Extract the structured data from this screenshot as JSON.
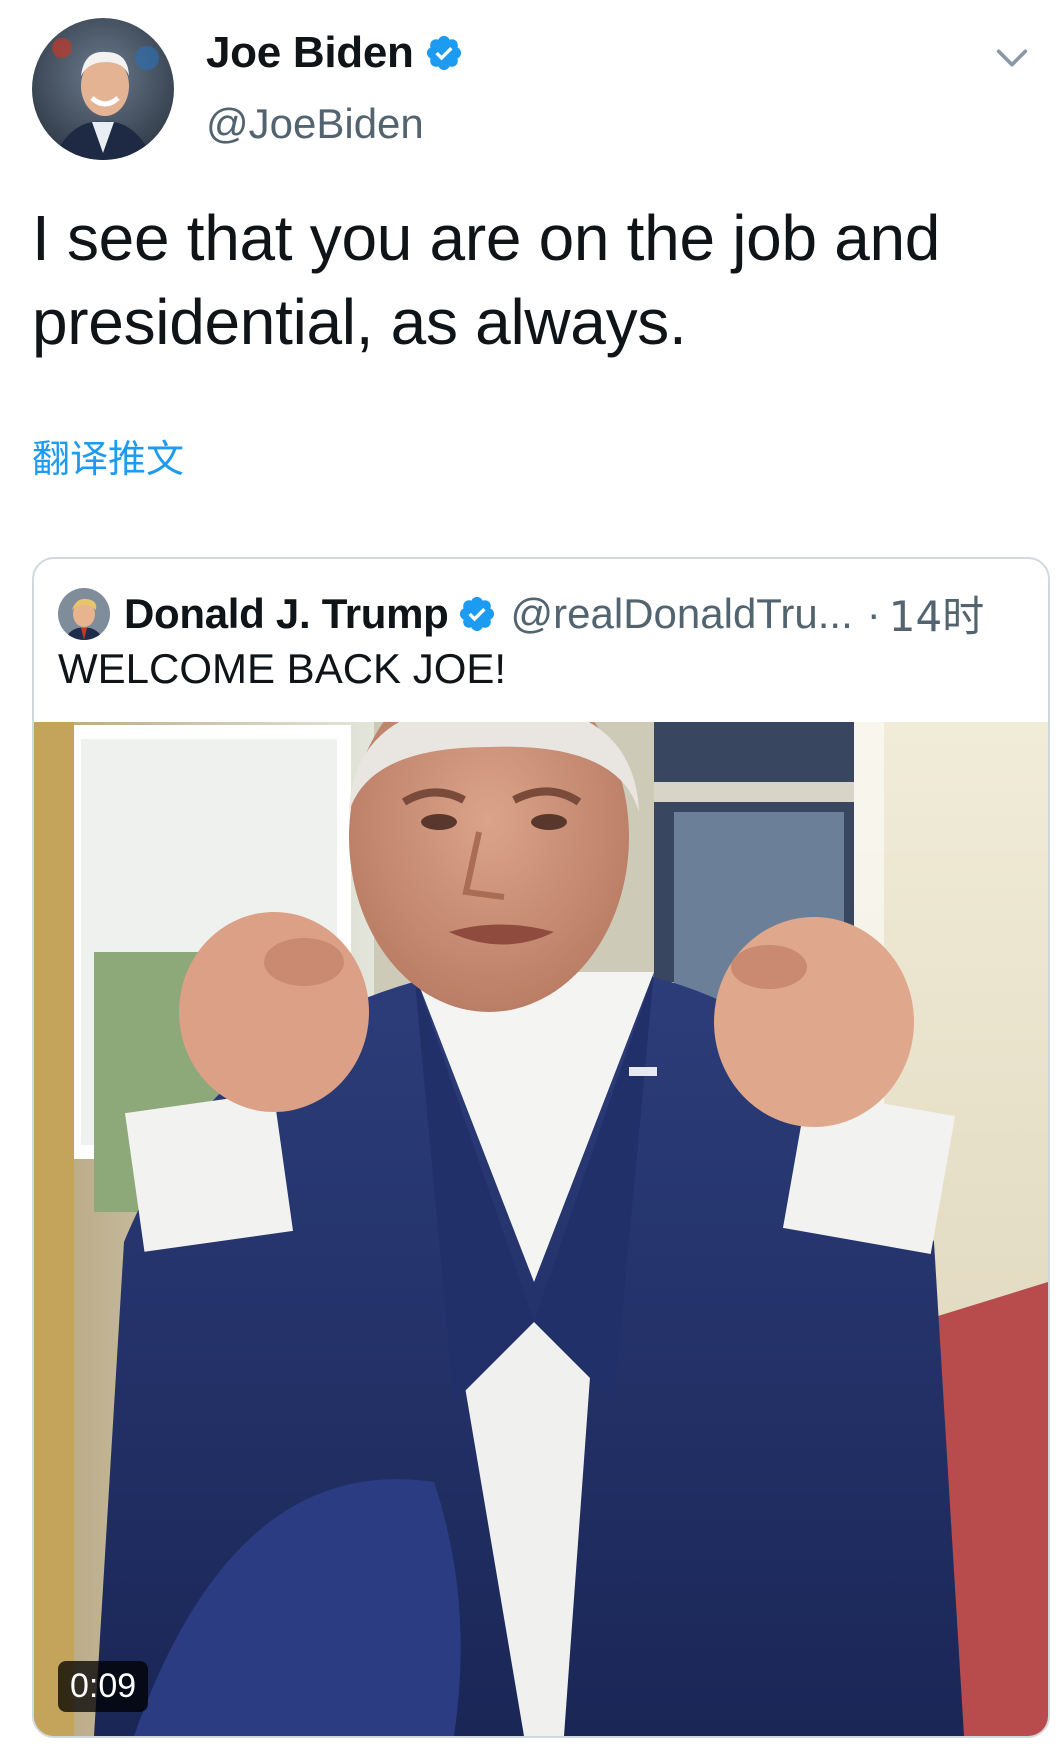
{
  "tweet": {
    "author": {
      "name": "Joe Biden",
      "handle": "@JoeBiden",
      "verified": true
    },
    "text": "I see that you are on the job and\npresidential, as always.",
    "translate_label": "翻译推文",
    "menu_icon": "chevron-down-icon"
  },
  "quoted_tweet": {
    "author": {
      "name": "Donald J. Trump",
      "handle": "@realDonaldTru...",
      "verified": true
    },
    "separator": "·",
    "time": "14时",
    "text": "WELCOME BACK JOE!",
    "video": {
      "duration": "0:09"
    }
  },
  "colors": {
    "verified_blue": "#1d9bf0",
    "link_blue": "#1d9bf0",
    "secondary_text": "#536471",
    "border": "#cfd9de"
  }
}
